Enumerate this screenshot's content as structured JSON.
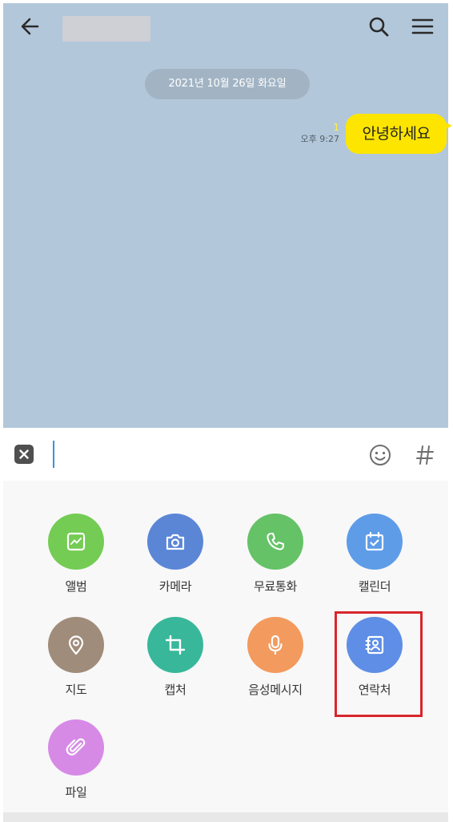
{
  "header": {
    "title": "",
    "back_icon": "arrow-left-icon",
    "search_icon": "search-icon",
    "menu_icon": "hamburger-menu-icon"
  },
  "chat": {
    "date_divider": "2021년 10월 26일 화요일",
    "messages": [
      {
        "text": "안녕하세요",
        "time": "오후 9:27",
        "unread": "1",
        "sender": "me"
      }
    ]
  },
  "input_bar": {
    "value": "",
    "placeholder": "",
    "close_icon": "close-icon",
    "emoji_icon": "emoji-icon",
    "hashtag_label": "#"
  },
  "attachments": [
    {
      "label": "앨범",
      "icon": "album-icon",
      "color": "#74cc54"
    },
    {
      "label": "카메라",
      "icon": "camera-icon",
      "color": "#5b86d6"
    },
    {
      "label": "무료통화",
      "icon": "phone-icon",
      "color": "#65c266"
    },
    {
      "label": "캘린더",
      "icon": "calendar-icon",
      "color": "#5e9ce8"
    },
    {
      "label": "지도",
      "icon": "map-pin-icon",
      "color": "#a08c7a"
    },
    {
      "label": "캡처",
      "icon": "crop-icon",
      "color": "#38b79a"
    },
    {
      "label": "음성메시지",
      "icon": "microphone-icon",
      "color": "#f39a5e"
    },
    {
      "label": "연락처",
      "icon": "contact-icon",
      "color": "#5e8ee6"
    },
    {
      "label": "파일",
      "icon": "paperclip-icon",
      "color": "#d68ae6"
    }
  ],
  "colors": {
    "chat_background": "#b2c7da",
    "my_bubble": "#fee500",
    "unread_count": "#fff04d",
    "highlight_border": "#d8262c"
  }
}
